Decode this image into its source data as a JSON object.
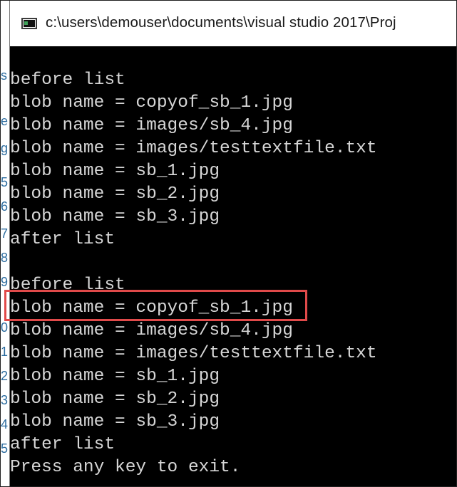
{
  "window": {
    "title": "c:\\users\\demouser\\documents\\visual studio 2017\\Proj",
    "icon": "console-app-icon"
  },
  "editor_strip": {
    "glyphs": [
      "s",
      "e",
      "g",
      "5",
      "6",
      "7",
      "8",
      "9",
      "0",
      "1",
      "2",
      "3",
      "4",
      "5"
    ]
  },
  "console": {
    "lines": [
      "before list",
      "blob name = copyof_sb_1.jpg",
      "blob name = images/sb_4.jpg",
      "blob name = images/testtextfile.txt",
      "blob name = sb_1.jpg",
      "blob name = sb_2.jpg",
      "blob name = sb_3.jpg",
      "after list",
      "",
      "before list",
      "blob name = copyof_sb_1.jpg",
      "blob name = images/sb_4.jpg",
      "blob name = images/testtextfile.txt",
      "blob name = sb_1.jpg",
      "blob name = sb_2.jpg",
      "blob name = sb_3.jpg",
      "after list",
      "Press any key to exit."
    ],
    "highlighted_line_index": 10,
    "highlight_color": "#e04a4a",
    "text_color": "#d6d6d6",
    "background": "#000000"
  }
}
